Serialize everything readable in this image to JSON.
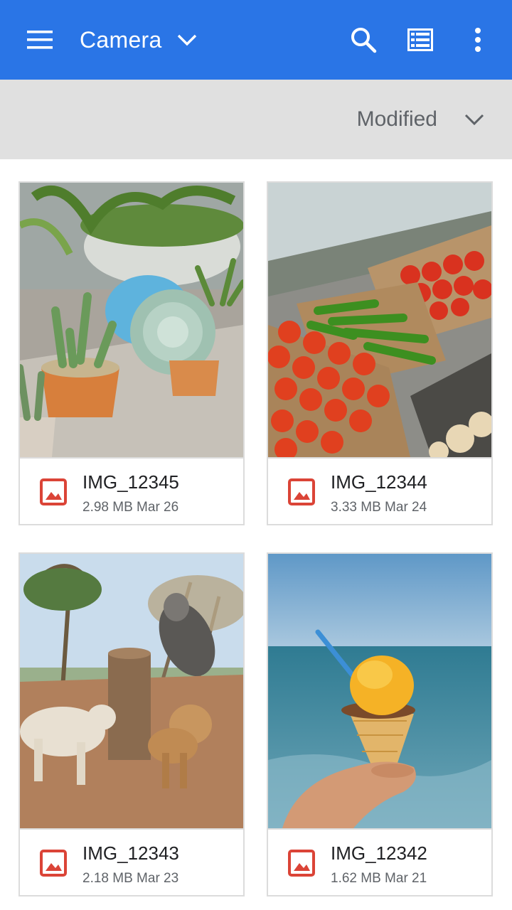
{
  "appbar": {
    "title": "Camera",
    "icons": [
      "menu-icon",
      "chevron-down-icon",
      "search-icon",
      "list-view-icon",
      "more-vert-icon"
    ],
    "color": "#2a75e6"
  },
  "sortbar": {
    "label": "Modified",
    "icon": "chevron-down-icon"
  },
  "files": [
    {
      "name": "IMG_12345",
      "size": "2.98 MB",
      "date": "Mar 26"
    },
    {
      "name": "IMG_12344",
      "size": "3.33 MB",
      "date": "Mar 24"
    },
    {
      "name": "IMG_12343",
      "size": "2.18 MB",
      "date": "Mar 23"
    },
    {
      "name": "IMG_12342",
      "size": "1.62 MB",
      "date": "Mar 21"
    }
  ],
  "colors": {
    "image_icon": "#db4437",
    "sortbar_bg": "#e0e0e0"
  }
}
